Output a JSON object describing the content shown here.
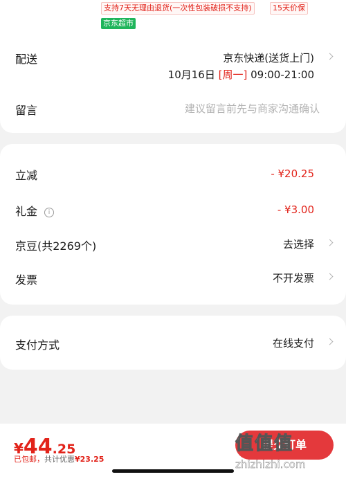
{
  "product": {
    "tags": [
      "支持7天无理由退货(一次性包装破损不支持)",
      "15天价保"
    ],
    "store_badge": "京东超市"
  },
  "delivery": {
    "label": "配送",
    "method": "京东快递(送货上门)",
    "date": "10月16日",
    "weekday": "[周一]",
    "time": "09:00-21:00"
  },
  "note": {
    "label": "留言",
    "placeholder": "建议留言前先与商家沟通确认"
  },
  "discounts": {
    "instant": {
      "label": "立减",
      "value": "- ¥20.25"
    },
    "gift": {
      "label": "礼金",
      "info_icon": "info-circle-icon",
      "value": "- ¥3.00"
    },
    "beans": {
      "label": "京豆(共2269个)",
      "value": "去选择"
    },
    "invoice": {
      "label": "发票",
      "value": "不开发票"
    }
  },
  "payment": {
    "label": "支付方式",
    "value": "在线支付"
  },
  "footer": {
    "currency": "¥",
    "price_int": "44",
    "price_dec": ".25",
    "shipping": "已包邮，",
    "savings_prefix": "共计优惠",
    "savings": "¥23.25",
    "submit_label": "提交订单"
  },
  "watermark": {
    "logo": "值值值",
    "url": "zhizhizhi.com"
  },
  "colors": {
    "accent": "#e2231a",
    "green_badge": "#1fb55b",
    "background": "#f2f2f2"
  }
}
